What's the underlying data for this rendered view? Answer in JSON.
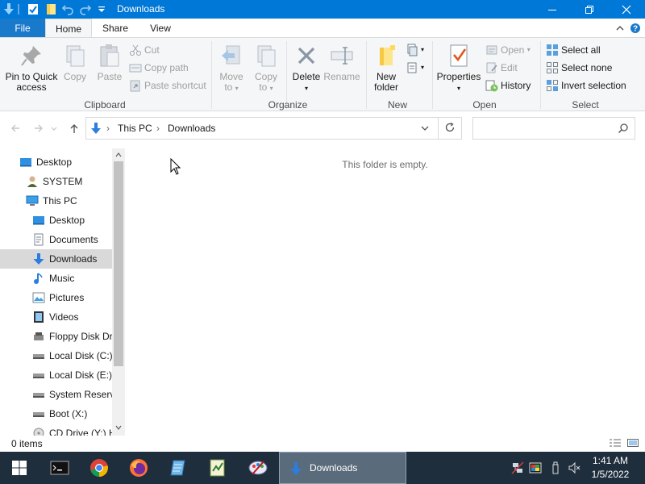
{
  "window": {
    "title": "Downloads"
  },
  "tabs": {
    "file": "File",
    "home": "Home",
    "share": "Share",
    "view": "View"
  },
  "ribbon": {
    "clipboard": {
      "label": "Clipboard",
      "pin": "Pin to Quick access",
      "pin_line1": "Pin to Quick",
      "pin_line2": "access",
      "copy": "Copy",
      "paste": "Paste",
      "cut": "Cut",
      "copy_path": "Copy path",
      "paste_shortcut": "Paste shortcut"
    },
    "organize": {
      "label": "Organize",
      "move_to_line1": "Move",
      "move_to_line2": "to",
      "copy_to_line1": "Copy",
      "copy_to_line2": "to",
      "delete": "Delete",
      "rename": "Rename"
    },
    "new": {
      "label": "New",
      "new_folder_line1": "New",
      "new_folder_line2": "folder"
    },
    "open": {
      "label": "Open",
      "properties": "Properties",
      "open": "Open",
      "edit": "Edit",
      "history": "History"
    },
    "select": {
      "label": "Select",
      "select_all": "Select all",
      "select_none": "Select none",
      "invert_selection": "Invert selection"
    }
  },
  "address": {
    "crumbs": [
      "This PC",
      "Downloads"
    ],
    "search_placeholder": ""
  },
  "navpane": {
    "items": [
      {
        "label": "Desktop",
        "icon": "desktop-icon"
      },
      {
        "label": "SYSTEM",
        "icon": "user-icon"
      },
      {
        "label": "This PC",
        "icon": "computer-icon"
      },
      {
        "label": "Desktop",
        "icon": "desktop-icon"
      },
      {
        "label": "Documents",
        "icon": "documents-icon"
      },
      {
        "label": "Downloads",
        "icon": "downloads-icon"
      },
      {
        "label": "Music",
        "icon": "music-icon"
      },
      {
        "label": "Pictures",
        "icon": "pictures-icon"
      },
      {
        "label": "Videos",
        "icon": "videos-icon"
      },
      {
        "label": "Floppy Disk Dri",
        "icon": "floppy-drive-icon"
      },
      {
        "label": "Local Disk (C:)",
        "icon": "drive-icon"
      },
      {
        "label": "Local Disk (E:)",
        "icon": "drive-icon"
      },
      {
        "label": "System Reserve",
        "icon": "drive-icon"
      },
      {
        "label": "Boot (X:)",
        "icon": "drive-icon"
      },
      {
        "label": "CD Drive (Y:) H",
        "icon": "cd-drive-icon"
      }
    ],
    "selected_index": 5
  },
  "content": {
    "empty_message": "This folder is empty."
  },
  "status": {
    "item_count": "0 items"
  },
  "taskbar": {
    "active_label": "Downloads",
    "time": "1:41 AM",
    "date": "1/5/2022"
  },
  "colors": {
    "titlebar": "#0078d7",
    "file_tab": "#1979ca",
    "taskbar": "#1f2e3d",
    "selected": "#d9d9d9"
  }
}
